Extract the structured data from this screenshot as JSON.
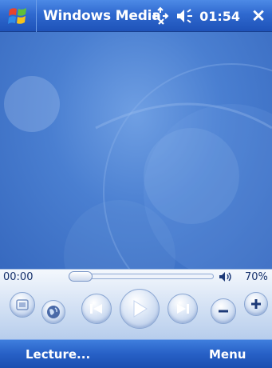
{
  "titlebar": {
    "app_title": "Windows Media",
    "clock": "01:54",
    "start_icon": "windows-flag-icon",
    "connectivity_icon": "connectivity-icon",
    "speaker_icon": "speaker-icon",
    "close_label": "✕"
  },
  "player": {
    "elapsed_time": "00:00",
    "seek_position": 0,
    "volume_label": "70%",
    "volume_level": 0.7
  },
  "controls": {
    "buttons": [
      "skin-icon",
      "web-icon",
      "previous-icon",
      "play-icon",
      "next-icon",
      "volume-down-icon",
      "volume-up-icon"
    ]
  },
  "menubar": {
    "left_softkey": "Lecture...",
    "right_softkey": "Menu"
  },
  "colors": {
    "titlebar": "#2f69cf",
    "video_background": "#4a7fd1",
    "control_panel": "#dfe9f7",
    "menubar": "#2760c6"
  }
}
